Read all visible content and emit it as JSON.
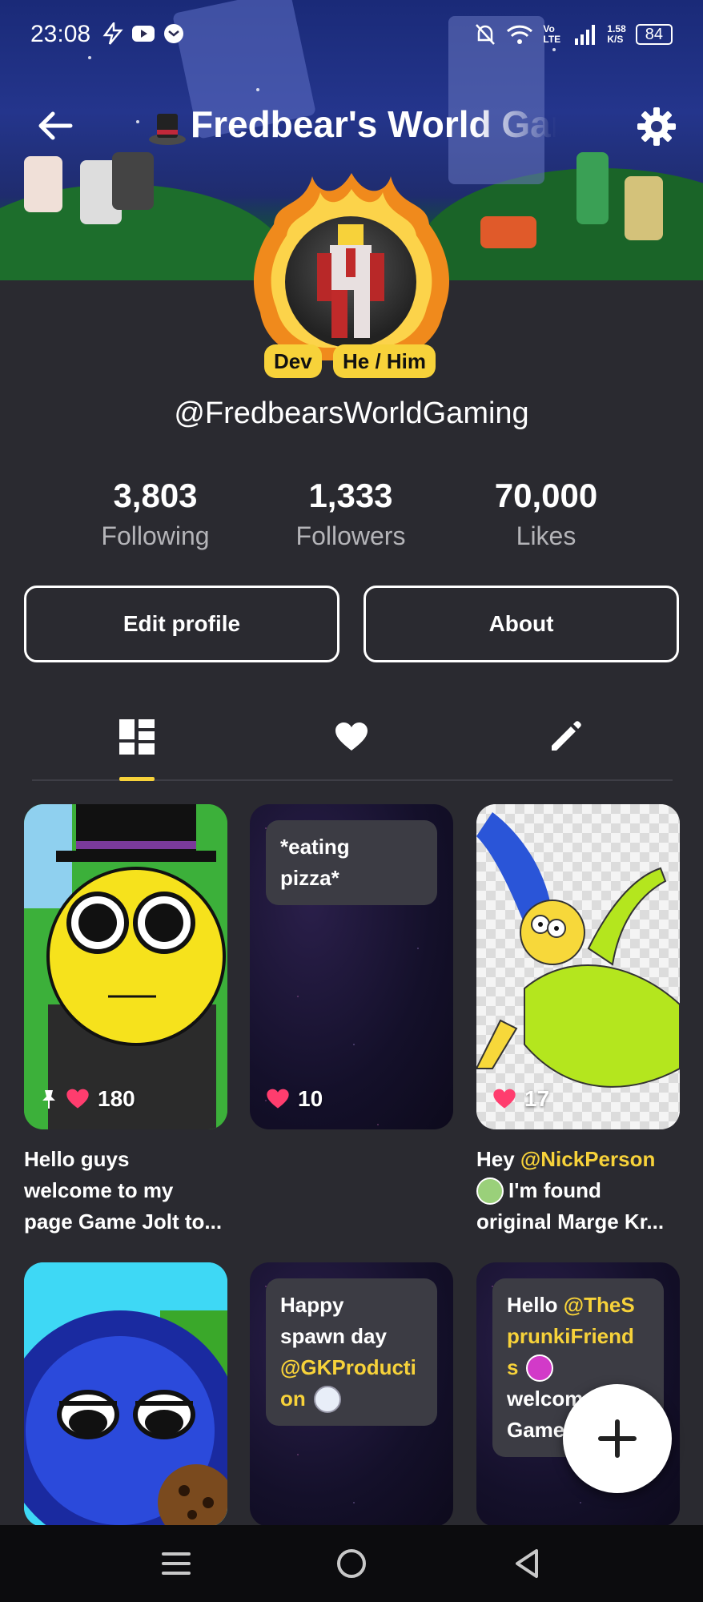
{
  "status_bar": {
    "time": "23:08",
    "volte": "Vo LTE",
    "speed_value": "1.58",
    "speed_unit": "K/S",
    "battery": "84"
  },
  "header": {
    "title": "Fredbear's World Gaming",
    "back_icon": "arrow-left-icon",
    "settings_icon": "gear-icon",
    "title_icon": "top-hat-icon"
  },
  "profile": {
    "badges": [
      "Dev",
      "He / Him"
    ],
    "handle": "@FredbearsWorldGaming",
    "stats": [
      {
        "value": "3,803",
        "label": "Following"
      },
      {
        "value": "1,333",
        "label": "Followers"
      },
      {
        "value": "70,000",
        "label": "Likes"
      }
    ],
    "edit_label": "Edit profile",
    "about_label": "About"
  },
  "tabs": [
    {
      "icon": "dashboard-grid-icon",
      "active": true
    },
    {
      "icon": "heart-icon",
      "active": false
    },
    {
      "icon": "pencil-icon",
      "active": false
    }
  ],
  "posts": [
    {
      "likes": "180",
      "pinned": true,
      "caption_lines": [
        "Hello guys",
        "welcome to my",
        "page Game Jolt to..."
      ]
    },
    {
      "likes": "10",
      "bubble_lines": [
        "*eating",
        "pizza*"
      ]
    },
    {
      "likes": "17",
      "caption_mention": "@NickPerson",
      "caption_prefix": "Hey ",
      "caption_lines": [
        "I'm found",
        "original Marge Kr..."
      ]
    },
    {
      "bubble_lines": []
    },
    {
      "bubble_prefix": [
        "Happy",
        "spawn day"
      ],
      "bubble_mention": [
        "@GKProducti",
        "on"
      ]
    },
    {
      "bubble_prefix": [
        "Hello "
      ],
      "bubble_mention": [
        "@TheS",
        "prunkiFriend",
        "s"
      ],
      "bubble_tail": [
        "welcom",
        "Game"
      ]
    }
  ],
  "fab_icon": "plus-icon",
  "nav": [
    "menu-icon",
    "home-circle-icon",
    "back-triangle-icon"
  ],
  "colors": {
    "accent": "#f7d23a",
    "like": "#ff3d6e",
    "background": "#2a2a30"
  }
}
